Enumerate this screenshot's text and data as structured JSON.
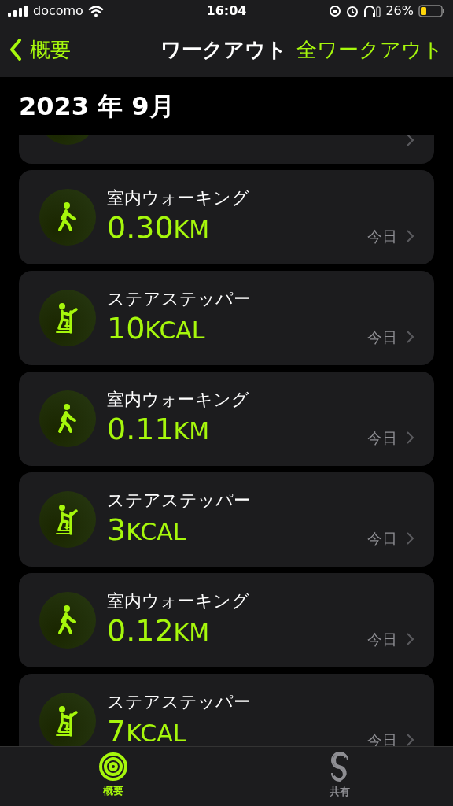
{
  "status_bar": {
    "carrier": "docomo",
    "time": "16:04",
    "battery": "26%"
  },
  "nav": {
    "back": "概要",
    "title": "ワークアウト",
    "action": "全ワークアウト"
  },
  "section": {
    "title": "2023 年 9月"
  },
  "workouts": [
    {
      "kind": "partial"
    },
    {
      "kind": "walking",
      "name": "室内ウォーキング",
      "value": "0.30",
      "unit": "KM",
      "date": "今日"
    },
    {
      "kind": "stair",
      "name": "ステアステッパー",
      "value": "10",
      "unit": "KCAL",
      "date": "今日"
    },
    {
      "kind": "walking",
      "name": "室内ウォーキング",
      "value": "0.11",
      "unit": "KM",
      "date": "今日"
    },
    {
      "kind": "stair",
      "name": "ステアステッパー",
      "value": "3",
      "unit": "KCAL",
      "date": "今日"
    },
    {
      "kind": "walking",
      "name": "室内ウォーキング",
      "value": "0.12",
      "unit": "KM",
      "date": "今日"
    },
    {
      "kind": "stair",
      "name": "ステアステッパー",
      "value": "7",
      "unit": "KCAL",
      "date": "今日"
    }
  ],
  "tabs": [
    {
      "kind": "rings",
      "label": "概要",
      "selected": true
    },
    {
      "kind": "sharing",
      "label": "共有",
      "selected": false
    }
  ]
}
